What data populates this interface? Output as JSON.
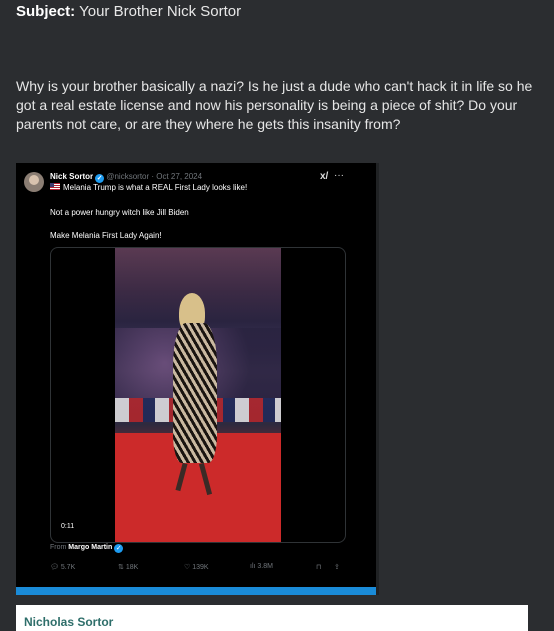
{
  "email": {
    "subject_label": "Subject:",
    "subject": "Your Brother Nick Sortor",
    "body": "Why is your brother basically a nazi?  Is he just a dude who can't hack it in life so he got a real estate license and now his personality is being a piece of shit?  Do your parents not care, or are they where he gets this insanity from?"
  },
  "tweet": {
    "author": "Nick Sortor",
    "handle": "@nicksortor · Oct 27, 2024",
    "line1": "Melania Trump is what a REAL First Lady looks like!",
    "line2": "Not a power hungry witch like Jill Biden",
    "line3": "Make Melania First Lady Again!",
    "video_time": "0:11",
    "from_prefix": "From",
    "from_name": "Margo Martin",
    "stats": {
      "replies": "5.7K",
      "retweets": "18K",
      "likes": "139K",
      "views": "3.8M"
    },
    "icons": {
      "grok": "grok-icon",
      "more": "more-icon",
      "flag": "us-flag-icon",
      "reply": "reply-icon",
      "retweet": "retweet-icon",
      "like": "heart-icon",
      "views": "views-icon",
      "bookmark": "bookmark-icon",
      "share": "share-icon"
    }
  },
  "card": {
    "name": "Nicholas Sortor"
  },
  "colors": {
    "background": "#2b2d30",
    "verified": "#1d9bf0",
    "name_accent": "#2e6e6a"
  }
}
